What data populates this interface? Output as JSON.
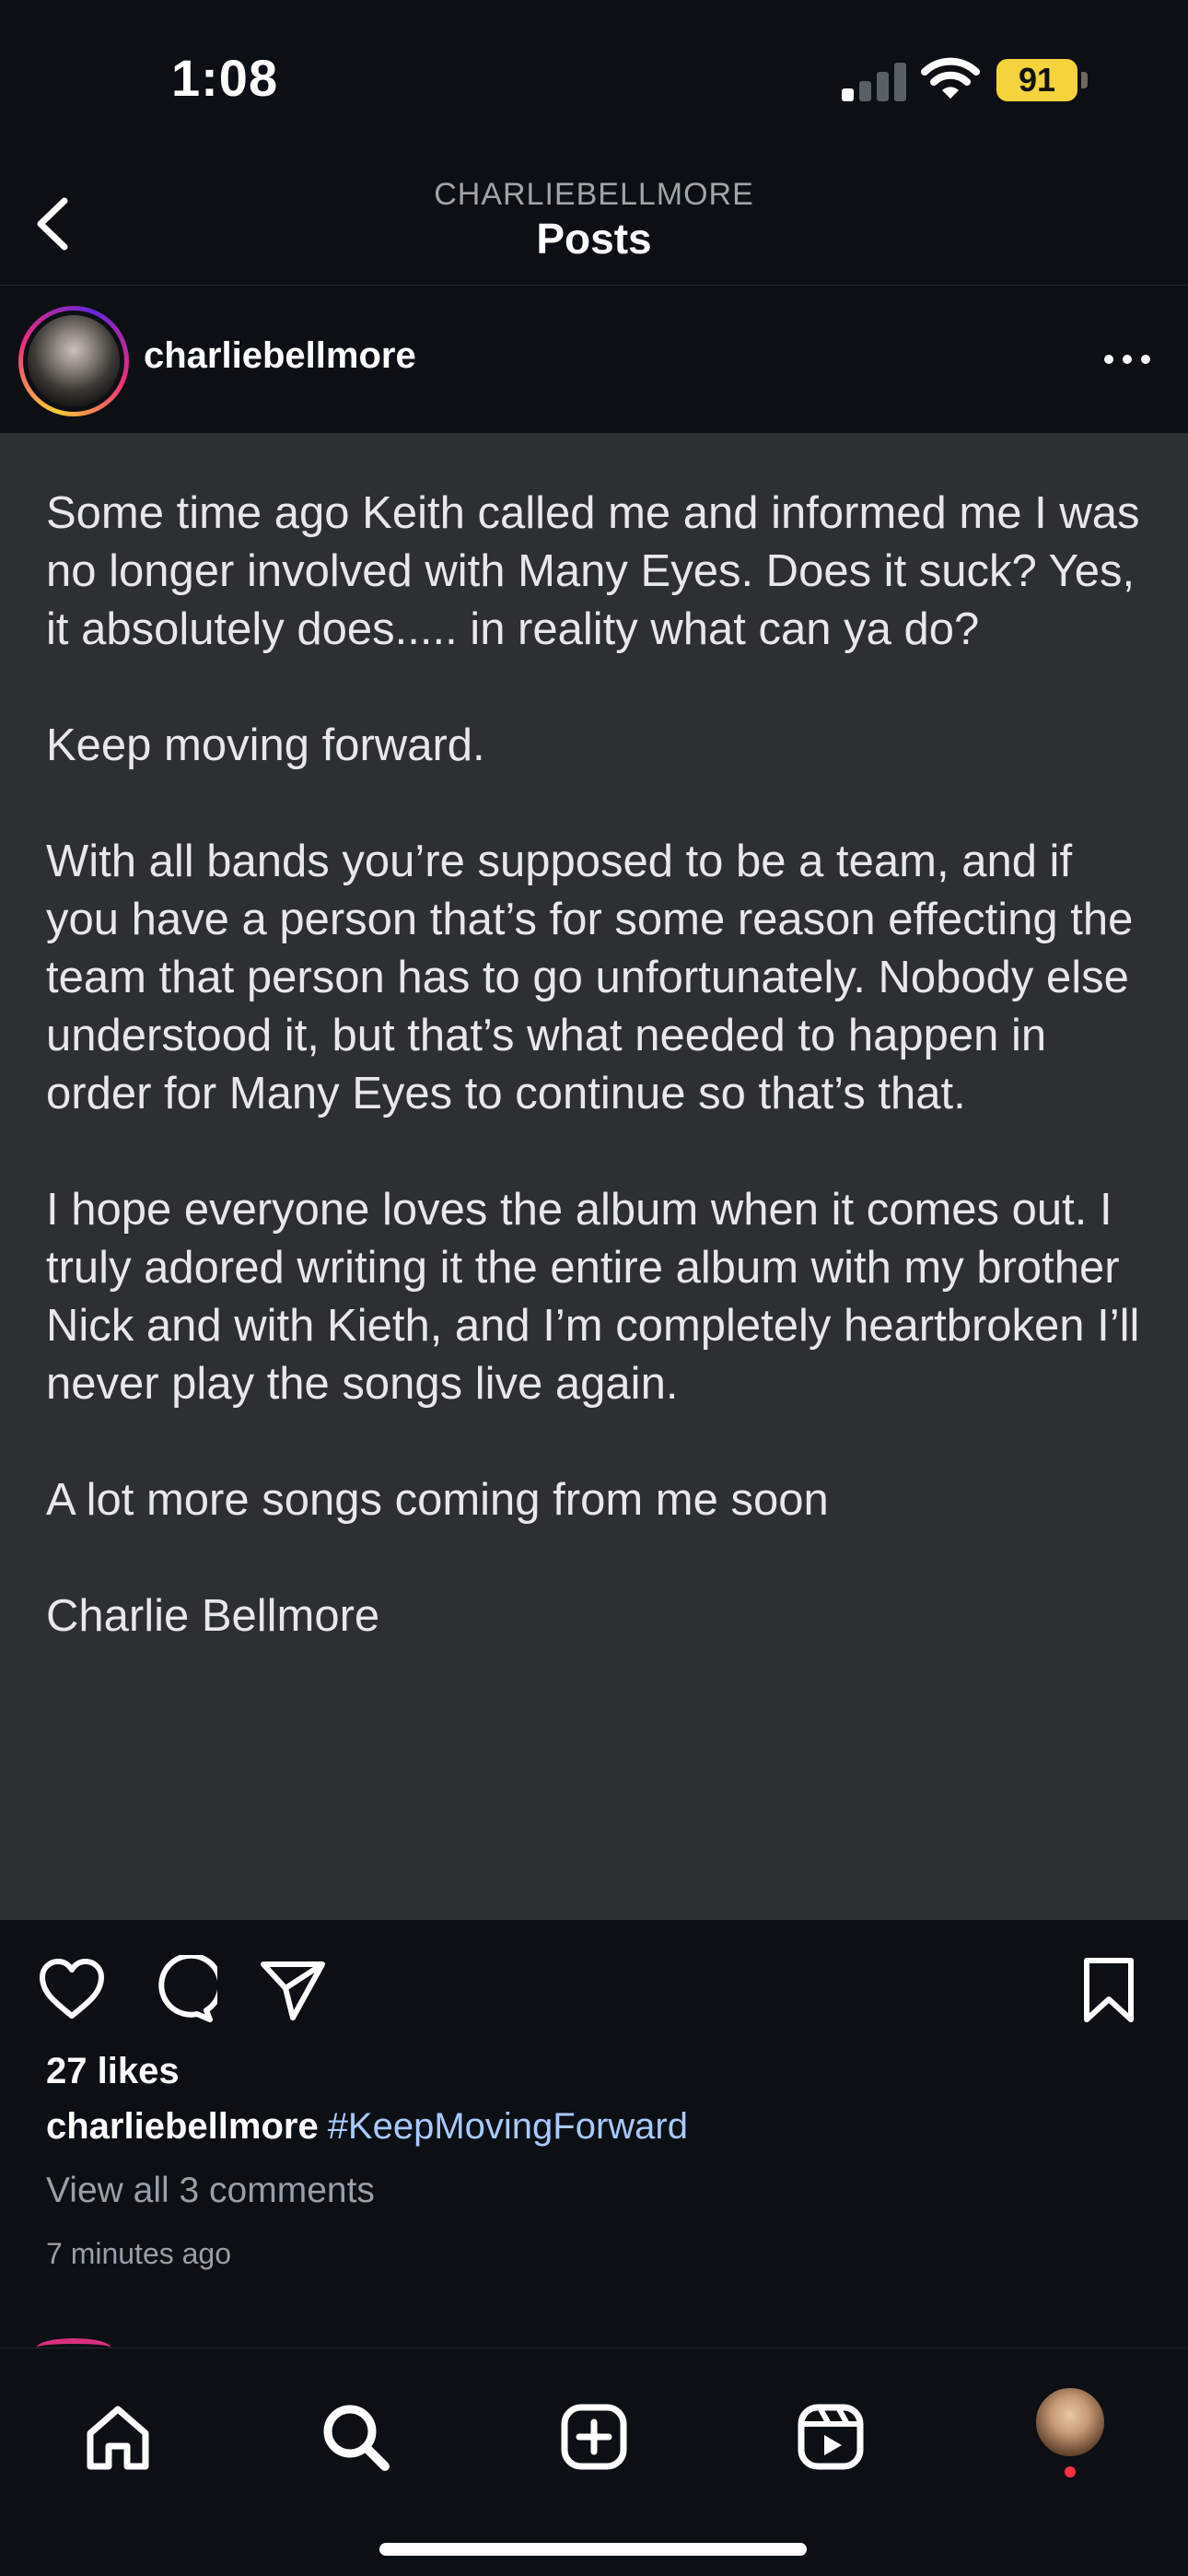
{
  "status_bar": {
    "time": "1:08",
    "battery_level": "91",
    "signal_bars_active": 1,
    "icons": [
      "signal-icon",
      "wifi-icon",
      "battery-icon"
    ]
  },
  "header": {
    "subtitle": "CHARLIEBELLMORE",
    "title": "Posts"
  },
  "post": {
    "username": "charliebellmore",
    "text": "Some time ago Keith called me and informed me I was no longer involved with Many Eyes. Does it suck? Yes, it absolutely does..... in reality what can ya do?\n\nKeep moving forward.\n\nWith all bands you’re supposed to be a team, and if you have a person that’s for some reason effecting the team that person has to go unfortunately. Nobody else understood it, but that’s what needed to happen in order for Many Eyes to continue so that’s that.\n\nI hope everyone loves the album when it comes out. I truly adored writing it the entire album with my brother Nick and with Kieth, and I’m completely heartbroken I’ll never play the songs live again.\n\nA lot more songs coming from me soon\n\nCharlie Bellmore",
    "likes": "27 likes",
    "caption_user": "charliebellmore",
    "caption_tag": "#KeepMovingForward",
    "comments_link": "View all 3 comments",
    "timestamp": "7 minutes ago"
  },
  "tab_bar": {
    "items": [
      "home-icon",
      "search-icon",
      "create-icon",
      "reels-icon",
      "profile-avatar"
    ]
  },
  "colors": {
    "background": "#0c0f14",
    "card": "#2e2f33",
    "hashtag": "#a9c9ff",
    "battery": "#f4d33c",
    "notification": "#ff3040"
  }
}
